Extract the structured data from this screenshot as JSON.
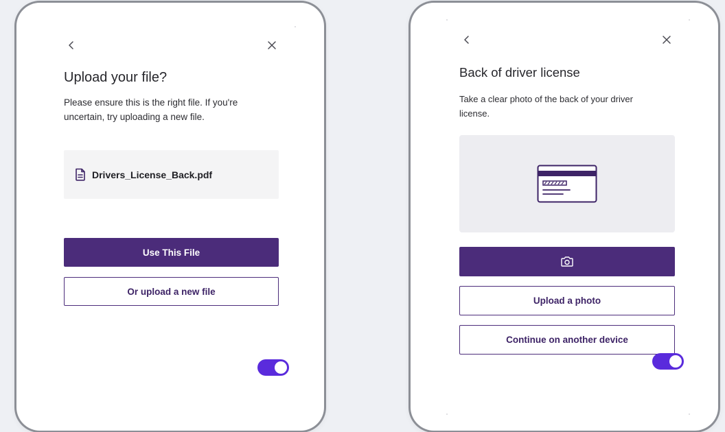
{
  "left_card": {
    "title": "Upload your file?",
    "description": "Please ensure this is the right file. If you're uncertain, try uploading a new file.",
    "file_name": "Drivers_License_Back.pdf",
    "primary_button": "Use This File",
    "secondary_button": "Or upload a new file",
    "toggle_on": true
  },
  "right_card": {
    "title": "Back of driver license",
    "description": "Take a clear photo of the back of your driver license.",
    "camera_button_icon": "camera-icon",
    "upload_button": "Upload a photo",
    "continue_button": "Continue on another device",
    "toggle_on": true
  },
  "colors": {
    "brand_purple": "#4b2c7a",
    "toggle_purple": "#5a2bdc",
    "page_background": "#eef0f4"
  },
  "icons": {
    "back": "chevron-left-icon",
    "close": "close-icon",
    "file": "document-icon",
    "card": "id-card-icon"
  }
}
